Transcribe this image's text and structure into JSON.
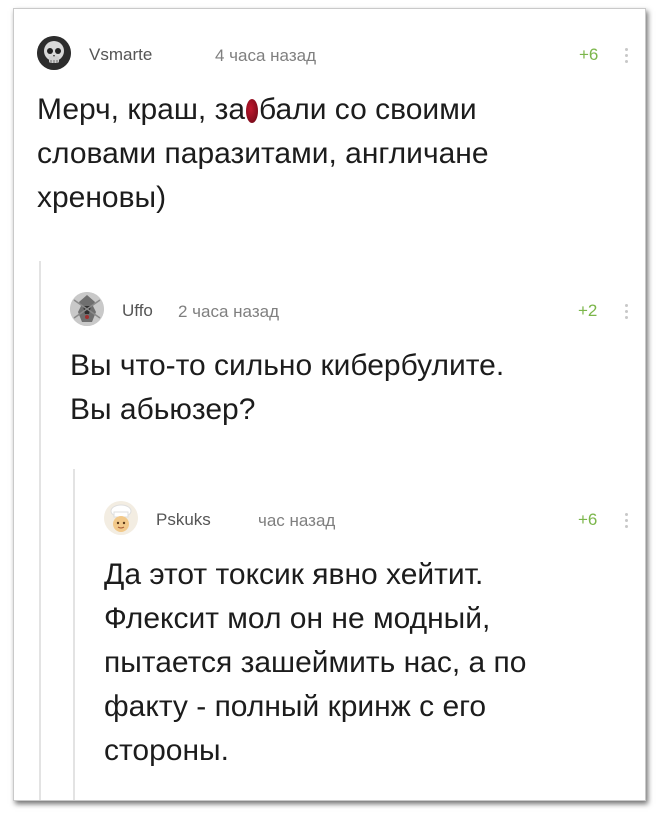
{
  "comments": [
    {
      "username": "Vsmarte",
      "time": "4 часа назад",
      "rating": "+6",
      "lines": [
        "Мерч, краш, за",
        "бали со своими",
        "словами паразитами, англичане",
        "хреновы)"
      ],
      "avatar_icon": "skull-icon"
    },
    {
      "username": "Uffo",
      "time": "2 часа назад",
      "rating": "+2",
      "lines": [
        "Вы что-то сильно кибербулите.",
        "Вы абьюзер?"
      ],
      "avatar_icon": "knight-icon"
    },
    {
      "username": "Pskuks",
      "time": "час назад",
      "rating": "+6",
      "lines": [
        "Да этот токсик явно хейтит.",
        "Флексит мол он не модный,",
        "пытается зашеймить нас, а по",
        "факту - полный кринж с его",
        "стороны."
      ],
      "avatar_icon": "chef-icon"
    }
  ],
  "colors": {
    "rating": "#7bb64a",
    "username": "#555555",
    "time": "#7f7f7f",
    "censor": "#8a0d1e"
  }
}
